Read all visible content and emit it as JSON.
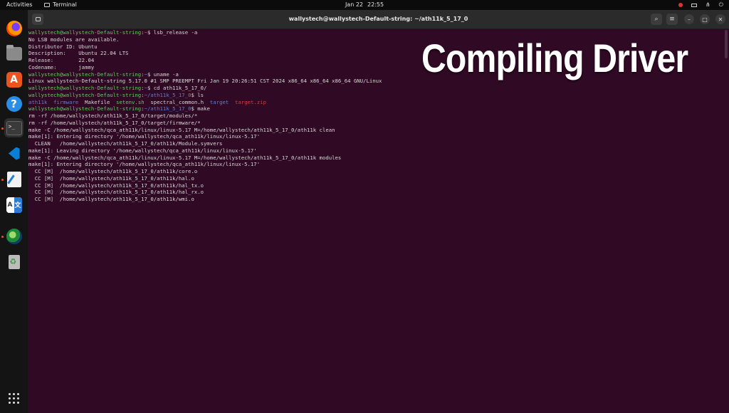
{
  "topbar": {
    "activities": "Activities",
    "app_name": "Terminal",
    "date": "Jan 22",
    "time": "22:55"
  },
  "dock": {
    "items": [
      {
        "name": "firefox"
      },
      {
        "name": "files"
      },
      {
        "name": "app-center"
      },
      {
        "name": "help"
      },
      {
        "name": "terminal",
        "active": true
      },
      {
        "name": "vscode"
      },
      {
        "name": "text-editor"
      },
      {
        "name": "translate"
      },
      {
        "name": "globe-app"
      },
      {
        "name": "trash"
      },
      {
        "name": "show-apps"
      }
    ]
  },
  "window": {
    "title": "wallystech@wallystech-Default-string: ~/ath11k_5_17_0"
  },
  "terminal": {
    "user_host": "wallystech@wallystech-Default-string",
    "lines": [
      {
        "type": "prompt",
        "path": "~",
        "cmd": "lsb_release -a"
      },
      {
        "type": "out",
        "text": "No LSB modules are available."
      },
      {
        "type": "out",
        "text": "Distributor ID:\tUbuntu"
      },
      {
        "type": "out",
        "text": "Description:    Ubuntu 22.04 LTS"
      },
      {
        "type": "out",
        "text": "Release:        22.04"
      },
      {
        "type": "out",
        "text": "Codename:       jammy"
      },
      {
        "type": "prompt",
        "path": "~",
        "cmd": "uname -a"
      },
      {
        "type": "out",
        "text": "Linux wallystech-Default-string 5.17.0 #1 SMP PREEMPT Fri Jan 19 20:26:51 CST 2024 x86_64 x86_64 x86_64 GNU/Linux"
      },
      {
        "type": "prompt",
        "path": "~",
        "cmd": "cd ath11k_5_17_0/"
      },
      {
        "type": "prompt",
        "path": "~/ath11k_5_17_0",
        "cmd": "ls"
      },
      {
        "type": "ls",
        "entries": [
          {
            "text": "ath11k",
            "kind": "dir"
          },
          {
            "text": "firmware",
            "kind": "dir"
          },
          {
            "text": "Makefile",
            "kind": "file"
          },
          {
            "text": "setenv.sh",
            "kind": "exec"
          },
          {
            "text": "spectral_common.h",
            "kind": "file"
          },
          {
            "text": "target",
            "kind": "dir"
          },
          {
            "text": "target.zip",
            "kind": "archive"
          }
        ]
      },
      {
        "type": "prompt",
        "path": "~/ath11k_5_17_0",
        "cmd": "make"
      },
      {
        "type": "out",
        "text": "rm -rf /home/wallystech/ath11k_5_17_0/target/modules/*"
      },
      {
        "type": "out",
        "text": "rm -rf /home/wallystech/ath11k_5_17_0/target/firmware/*"
      },
      {
        "type": "out",
        "text": "make -C /home/wallystech/qca_ath11k/linux/linux-5.17 M=/home/wallystech/ath11k_5_17_0/ath11k clean"
      },
      {
        "type": "out",
        "text": "make[1]: Entering directory '/home/wallystech/qca_ath11k/linux/linux-5.17'"
      },
      {
        "type": "out",
        "text": "  CLEAN   /home/wallystech/ath11k_5_17_0/ath11k/Module.symvers"
      },
      {
        "type": "out",
        "text": "make[1]: Leaving directory '/home/wallystech/qca_ath11k/linux/linux-5.17'"
      },
      {
        "type": "out",
        "text": "make -C /home/wallystech/qca_ath11k/linux/linux-5.17 M=/home/wallystech/ath11k_5_17_0/ath11k modules"
      },
      {
        "type": "out",
        "text": "make[1]: Entering directory '/home/wallystech/qca_ath11k/linux/linux-5.17'"
      },
      {
        "type": "out",
        "text": "  CC [M]  /home/wallystech/ath11k_5_17_0/ath11k/core.o"
      },
      {
        "type": "out",
        "text": "  CC [M]  /home/wallystech/ath11k_5_17_0/ath11k/hal.o"
      },
      {
        "type": "out",
        "text": "  CC [M]  /home/wallystech/ath11k_5_17_0/ath11k/hal_tx.o"
      },
      {
        "type": "out",
        "text": "  CC [M]  /home/wallystech/ath11k_5_17_0/ath11k/hal_rx.o"
      },
      {
        "type": "out",
        "text": "  CC [M]  /home/wallystech/ath11k_5_17_0/ath11k/wmi.o"
      }
    ]
  },
  "overlay": {
    "text": "Compiling Driver"
  },
  "colors": {
    "terminal_bg": "#300a24",
    "prompt_user": "#5ad35a",
    "prompt_path": "#5a7fd6",
    "dir": "#5a7fd6",
    "exec": "#5ad35a",
    "archive": "#d33b3b"
  }
}
